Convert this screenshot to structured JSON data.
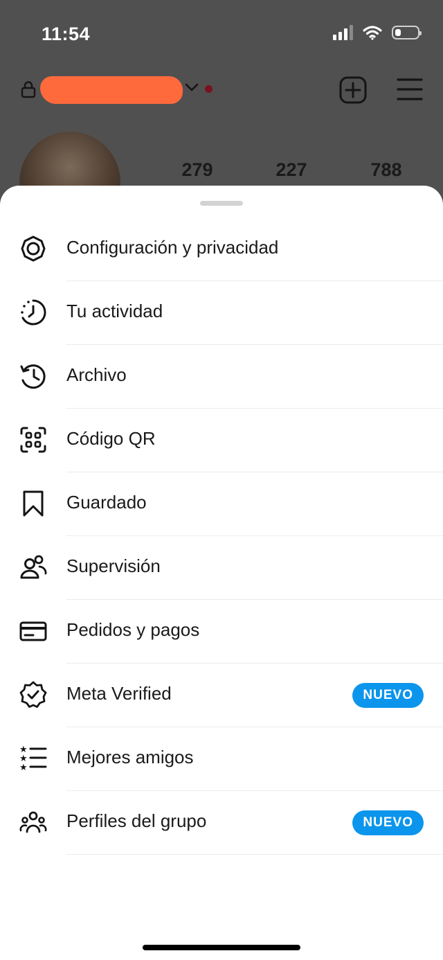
{
  "status_bar": {
    "time": "11:54",
    "signal_icon": "signal-icon",
    "wifi_icon": "wifi-icon",
    "battery_icon": "battery-icon",
    "battery_level": 0.25
  },
  "profile": {
    "lock_icon": "lock-icon",
    "chevron_icon": "chevron-down-icon",
    "add_icon": "plus-square-icon",
    "menu_icon": "hamburger-menu-icon",
    "stats": [
      "279",
      "227",
      "788"
    ]
  },
  "sheet": {
    "items": [
      {
        "label": "Configuración y privacidad",
        "icon": "settings-gear-icon",
        "badge": ""
      },
      {
        "label": "Tu actividad",
        "icon": "activity-clock-icon",
        "badge": ""
      },
      {
        "label": "Archivo",
        "icon": "archive-history-icon",
        "badge": ""
      },
      {
        "label": "Código QR",
        "icon": "qr-code-icon",
        "badge": ""
      },
      {
        "label": "Guardado",
        "icon": "bookmark-icon",
        "badge": ""
      },
      {
        "label": "Supervisión",
        "icon": "supervision-users-icon",
        "badge": ""
      },
      {
        "label": "Pedidos y pagos",
        "icon": "credit-card-icon",
        "badge": ""
      },
      {
        "label": "Meta Verified",
        "icon": "verified-badge-icon",
        "badge": "NUEVO"
      },
      {
        "label": "Mejores amigos",
        "icon": "close-friends-list-icon",
        "badge": ""
      },
      {
        "label": "Perfiles del grupo",
        "icon": "group-profiles-icon",
        "badge": "NUEVO"
      }
    ]
  },
  "colors": {
    "badge": "#0c95ec",
    "redaction": "#ff6a3d",
    "dim_background": "#505050"
  }
}
